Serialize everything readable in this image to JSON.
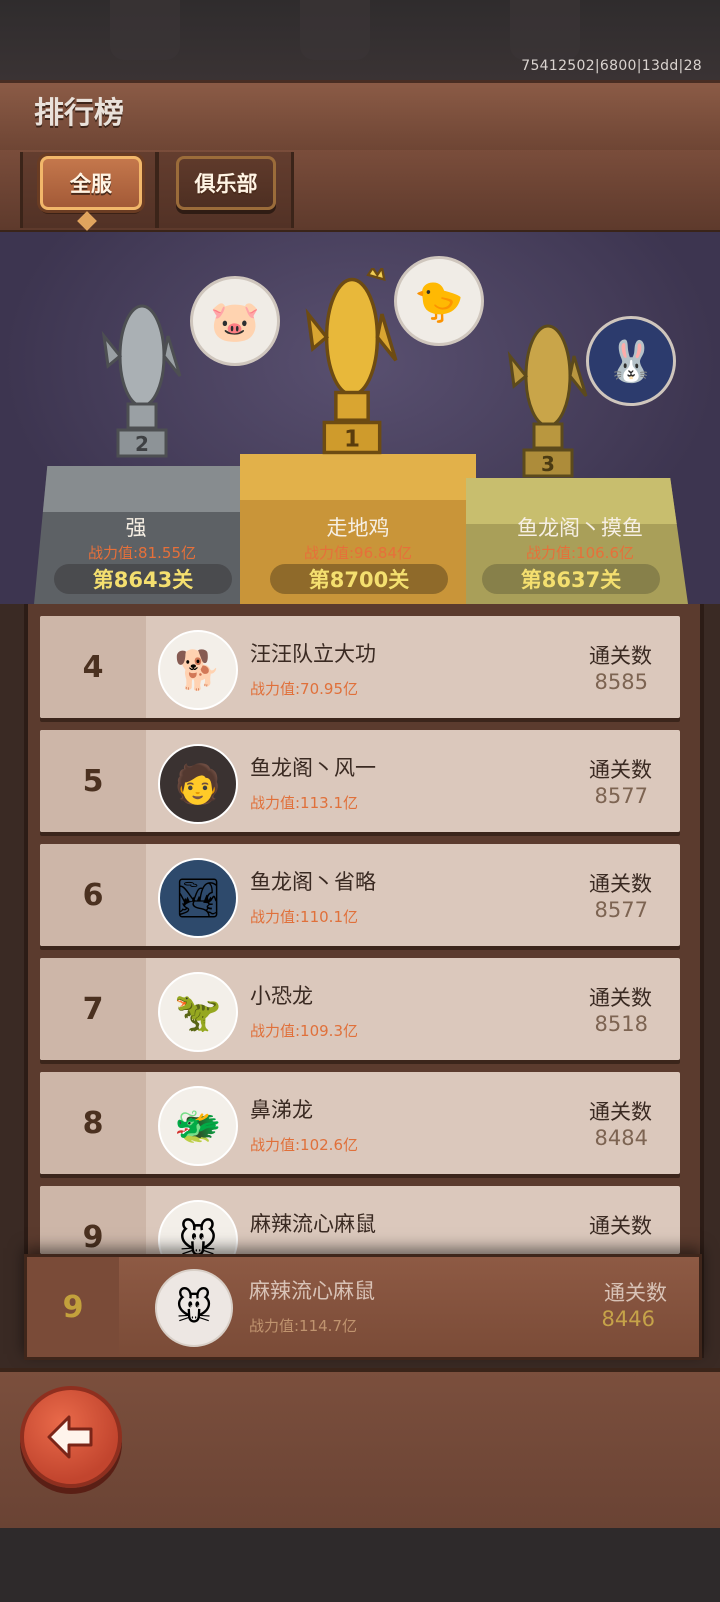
{
  "build_id": "75412502|6800|13dd|28",
  "header": {
    "title": "排行榜"
  },
  "tabs": [
    {
      "label": "全服",
      "active": true
    },
    {
      "label": "俱乐部",
      "active": false
    }
  ],
  "podium": [
    {
      "place": "2",
      "name": "强",
      "power": "战力值:81.55亿",
      "level": "第8643关",
      "avatar_icon": "pig-icon"
    },
    {
      "place": "1",
      "name": "走地鸡",
      "power": "战力值:96.84亿",
      "level": "第8700关",
      "avatar_icon": "chick-icon"
    },
    {
      "place": "3",
      "name": "鱼龙阁丶摸鱼",
      "power": "战力值:106.6亿",
      "level": "第8637关",
      "avatar_icon": "rabbit-icon"
    }
  ],
  "list": [
    {
      "rank": "4",
      "name": "汪汪队立大功",
      "power": "战力值:70.95亿",
      "pass_label": "通关数",
      "pass_value": "8585",
      "avatar_icon": "shiba-icon"
    },
    {
      "rank": "5",
      "name": "鱼龙阁丶风一",
      "power": "战力值:113.1亿",
      "pass_label": "通关数",
      "pass_value": "8577",
      "avatar_icon": "person-icon"
    },
    {
      "rank": "6",
      "name": "鱼龙阁丶省略",
      "power": "战力值:110.1亿",
      "pass_label": "通关数",
      "pass_value": "8577",
      "avatar_icon": "landscape-icon"
    },
    {
      "rank": "7",
      "name": "小恐龙",
      "power": "战力值:109.3亿",
      "pass_label": "通关数",
      "pass_value": "8518",
      "avatar_icon": "dino-icon"
    },
    {
      "rank": "8",
      "name": "鼻涕龙",
      "power": "战力值:102.6亿",
      "pass_label": "通关数",
      "pass_value": "8484",
      "avatar_icon": "dragon-icon"
    },
    {
      "rank": "9",
      "name": "麻辣流心麻鼠",
      "pass_label": "通关数",
      "avatar_icon": "mouse-icon"
    }
  ],
  "my_rank": {
    "rank": "9",
    "name": "麻辣流心麻鼠",
    "power": "战力值:114.7亿",
    "pass_label": "通关数",
    "pass_value": "8446",
    "avatar_icon": "mouse-icon"
  },
  "colors": {
    "accent_orange": "#e0703a",
    "gold_text": "#f4df6f",
    "wood": "#7a4d3b"
  }
}
